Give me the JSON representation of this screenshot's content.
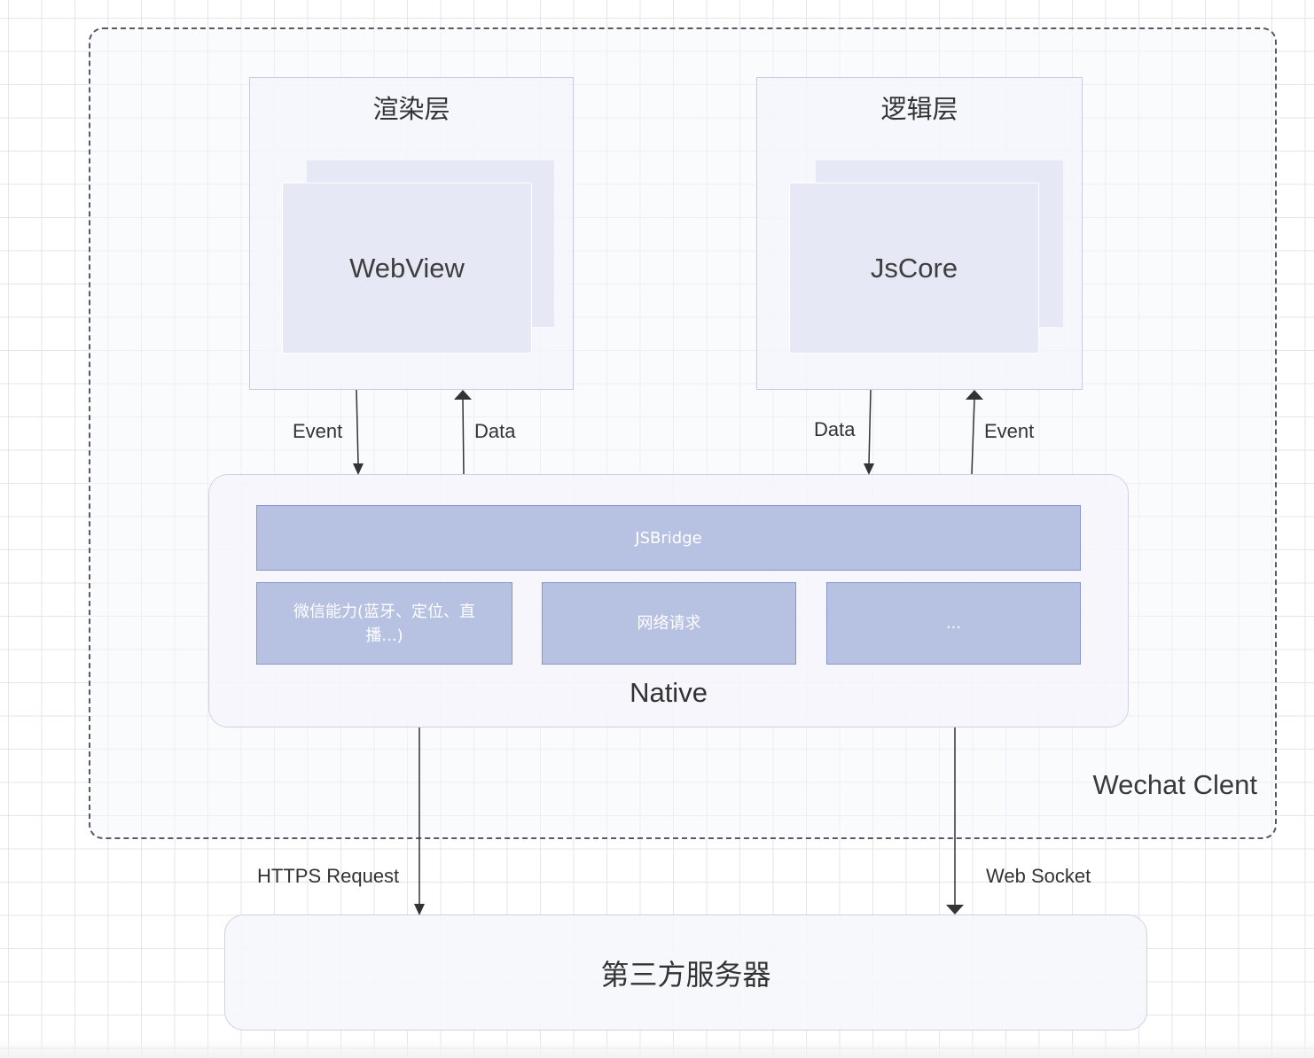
{
  "container": {
    "label": "Wechat Clent"
  },
  "render_layer": {
    "title": "渲染层",
    "card_label": "WebView"
  },
  "logic_layer": {
    "title": "逻辑层",
    "card_label": "JsCore"
  },
  "edges": {
    "render_down": "Event",
    "render_up": "Data",
    "logic_down": "Data",
    "logic_up": "Event",
    "https": "HTTPS Request",
    "socket": "Web Socket"
  },
  "native": {
    "label": "Native",
    "bridge": "JSBridge",
    "modules": [
      "微信能力(蓝牙、定位、直播...)",
      "网络请求",
      "..."
    ]
  },
  "server": {
    "label": "第三方服务器"
  }
}
